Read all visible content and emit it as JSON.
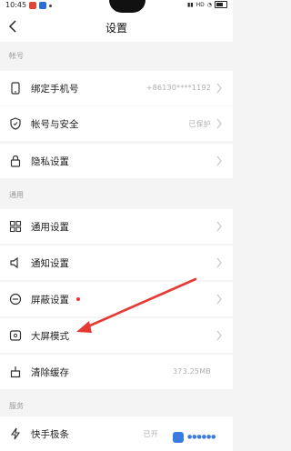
{
  "status_bar": {
    "time": "10:45",
    "net": "HD",
    "battery_icon": "battery-icon"
  },
  "header": {
    "title": "设置",
    "back_icon": "chevron-left-icon"
  },
  "sections": {
    "account": "帐号",
    "general": "通用",
    "service": "服务"
  },
  "rows": {
    "phone": {
      "label": "绑定手机号",
      "value": "+86130****1192",
      "icon": "phone-icon"
    },
    "security": {
      "label": "帐号与安全",
      "value": "已保护",
      "icon": "shield-icon"
    },
    "privacy": {
      "label": "隐私设置",
      "icon": "lock-icon"
    },
    "general_settings": {
      "label": "通用设置",
      "icon": "grid-icon"
    },
    "notification": {
      "label": "通知设置",
      "icon": "speaker-icon"
    },
    "block": {
      "label": "屏蔽设置",
      "icon": "block-icon",
      "badge_color": "#e53935"
    },
    "bigscreen": {
      "label": "大屏模式",
      "icon": "screen-icon"
    },
    "cache": {
      "label": "清除缓存",
      "value": "373.25MB",
      "icon": "broom-icon"
    },
    "fastbrush": {
      "label": "快手极条",
      "value": "已开",
      "icon": "lightning-icon"
    }
  },
  "annotation": {
    "arrow_color": "#e53935"
  },
  "colors": {
    "bg": "#f4f4f4",
    "row_bg": "#ffffff",
    "accent_red": "#e53935"
  }
}
